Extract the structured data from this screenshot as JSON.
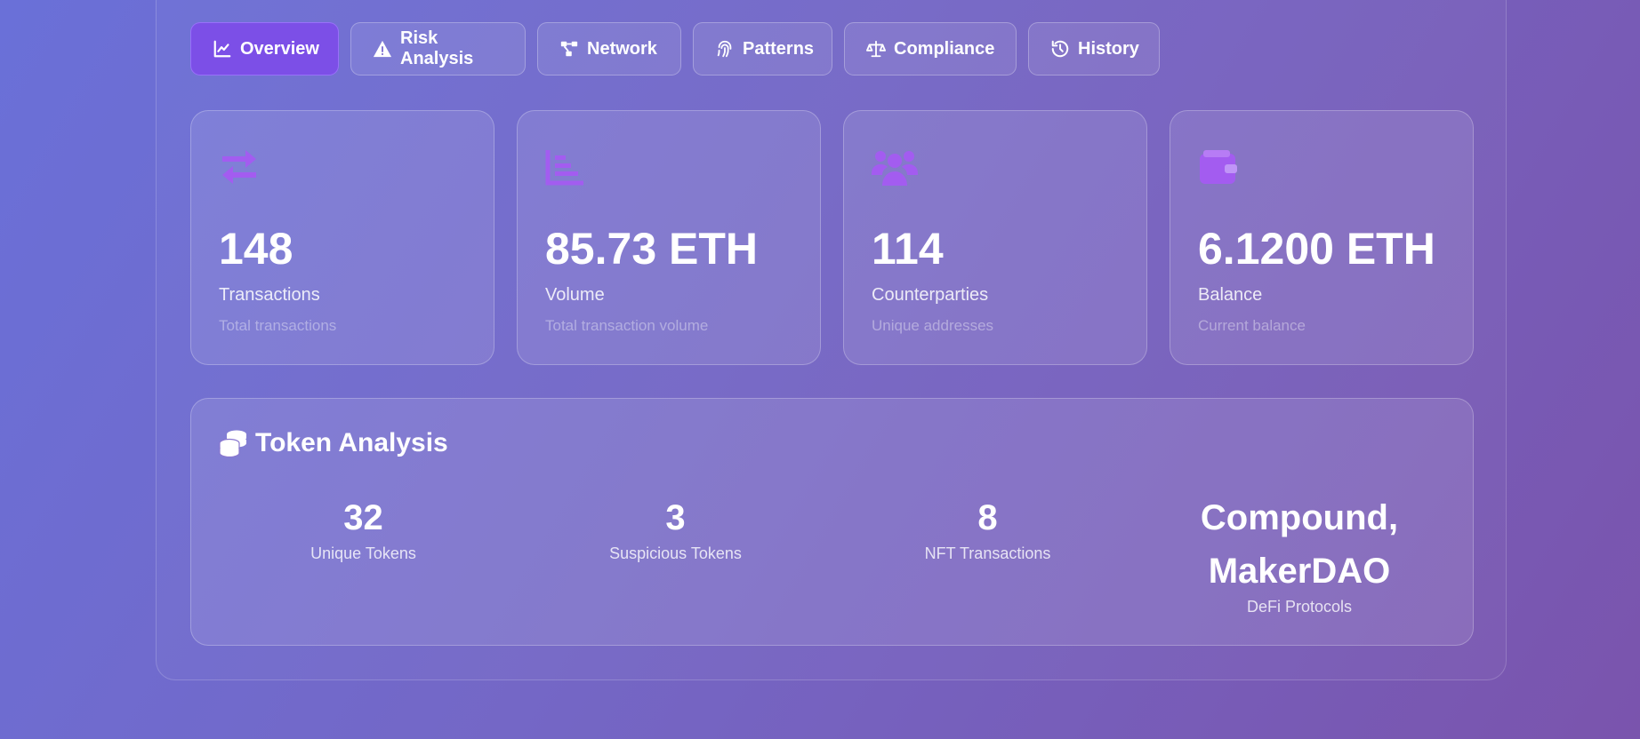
{
  "tabs": [
    {
      "label": "Overview",
      "icon": "chart-line-icon",
      "active": true
    },
    {
      "label": "Risk Analysis",
      "icon": "warning-icon",
      "active": false
    },
    {
      "label": "Network",
      "icon": "network-icon",
      "active": false
    },
    {
      "label": "Patterns",
      "icon": "fingerprint-icon",
      "active": false
    },
    {
      "label": "Compliance",
      "icon": "scale-icon",
      "active": false
    },
    {
      "label": "History",
      "icon": "history-icon",
      "active": false
    }
  ],
  "cards": [
    {
      "value": "148",
      "label": "Transactions",
      "desc": "Total transactions",
      "icon": "exchange-arrows-icon"
    },
    {
      "value": "85.73 ETH",
      "label": "Volume",
      "desc": "Total transaction volume",
      "icon": "chart-bar-icon"
    },
    {
      "value": "114",
      "label": "Counterparties",
      "desc": "Unique addresses",
      "icon": "users-icon"
    },
    {
      "value": "6.1200 ETH",
      "label": "Balance",
      "desc": "Current balance",
      "icon": "wallet-icon"
    }
  ],
  "token_analysis": {
    "title": "Token Analysis",
    "icon": "coins-icon",
    "stats": [
      {
        "value": "32",
        "label": "Unique Tokens"
      },
      {
        "value": "3",
        "label": "Suspicious Tokens"
      },
      {
        "value": "8",
        "label": "NFT Transactions"
      },
      {
        "value": "Compound, MakerDAO",
        "label": "DeFi Protocols"
      }
    ]
  },
  "colors": {
    "accent": "#7c4fe7",
    "icon_purple": "#a35cf0"
  }
}
